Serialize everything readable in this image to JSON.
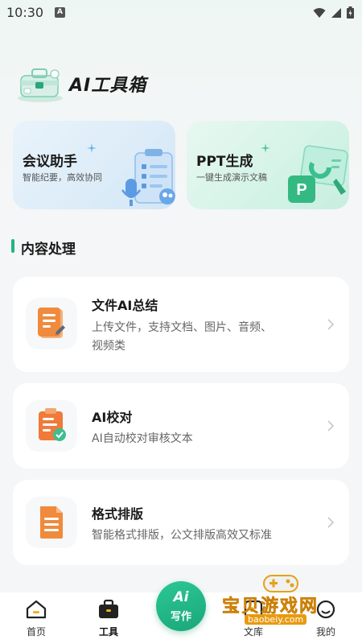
{
  "status_bar": {
    "time": "10:30",
    "notif_badge": "A"
  },
  "header": {
    "title": "AI工具箱"
  },
  "feature_cards": [
    {
      "title": "会议助手",
      "subtitle": "智能纪要，高效协同"
    },
    {
      "title": "PPT生成",
      "subtitle": "一键生成演示文稿"
    }
  ],
  "section": {
    "title": "内容处理"
  },
  "items": [
    {
      "title": "文件AI总结",
      "desc_line1": "上传文件，支持文档、图片、音频、",
      "desc_line2": "视频类"
    },
    {
      "title": "AI校对",
      "desc": "AI自动校对审核文本"
    },
    {
      "title": "格式排版",
      "desc": "智能格式排版，公文排版高效又标准"
    }
  ],
  "nav": {
    "home": "首页",
    "tools": "工具",
    "write_ai": "Ai",
    "write": "写作",
    "doc": "文库",
    "mine": "我的"
  },
  "watermark": {
    "text": "宝贝游戏网",
    "url": "baobeiy.com"
  },
  "colors": {
    "accent": "#24b47e",
    "icon_orange": "#f08a3c"
  }
}
